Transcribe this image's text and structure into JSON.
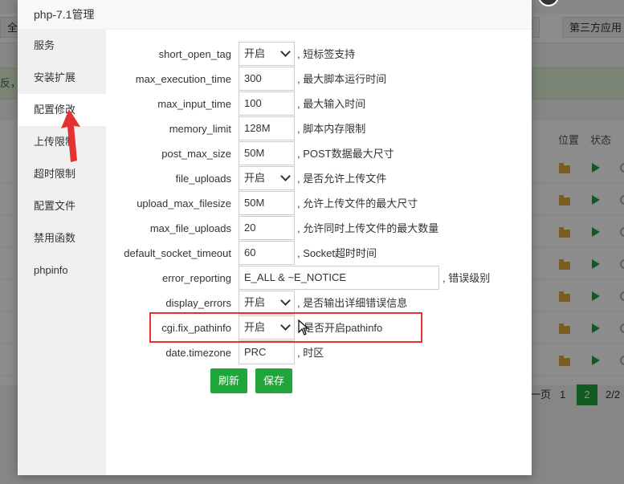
{
  "background": {
    "toolbar_left_label": "全",
    "toolbar_mid_label": "F",
    "toolbar_right_label": "第三方应用",
    "notice_text": "反，",
    "table_headers": {
      "location": "位置",
      "status": "状态"
    },
    "pagination": {
      "prev": "一页",
      "page1": "1",
      "page2": "2",
      "total": "2/2"
    }
  },
  "dialog": {
    "title": "php-7.1管理",
    "close_symbol": "×",
    "sidebar": [
      {
        "label": "服务"
      },
      {
        "label": "安装扩展"
      },
      {
        "label": "配置修改"
      },
      {
        "label": "上传限制"
      },
      {
        "label": "超时限制"
      },
      {
        "label": "配置文件"
      },
      {
        "label": "禁用函数"
      },
      {
        "label": "phpinfo"
      }
    ],
    "settings": [
      {
        "name": "short_open_tag",
        "value": "开启",
        "desc": ", 短标签支持"
      },
      {
        "name": "max_execution_time",
        "value": "300",
        "desc": ", 最大脚本运行时间"
      },
      {
        "name": "max_input_time",
        "value": "100",
        "desc": ", 最大输入时间"
      },
      {
        "name": "memory_limit",
        "value": "128M",
        "desc": ", 脚本内存限制"
      },
      {
        "name": "post_max_size",
        "value": "50M",
        "desc": ", POST数据最大尺寸"
      },
      {
        "name": "file_uploads",
        "value": "开启",
        "desc": ", 是否允许上传文件"
      },
      {
        "name": "upload_max_filesize",
        "value": "50M",
        "desc": ", 允许上传文件的最大尺寸"
      },
      {
        "name": "max_file_uploads",
        "value": "20",
        "desc": ", 允许同时上传文件的最大数量"
      },
      {
        "name": "default_socket_timeout",
        "value": "60",
        "desc": ", Socket超时时间"
      },
      {
        "name": "error_reporting",
        "value": "E_ALL & ~E_NOTICE",
        "desc": ", 错误级别"
      },
      {
        "name": "display_errors",
        "value": "开启",
        "desc": ", 是否输出详细错误信息"
      },
      {
        "name": "cgi.fix_pathinfo",
        "value": "开启",
        "desc": "是否开启pathinfo"
      },
      {
        "name": "date.timezone",
        "value": "PRC",
        "desc": ", 时区"
      }
    ],
    "refresh_label": "刷新",
    "save_label": "保存"
  },
  "colors": {
    "accent": "#20a53a",
    "highlight": "#e5312f",
    "annotation_arrow": "#e5312f"
  }
}
